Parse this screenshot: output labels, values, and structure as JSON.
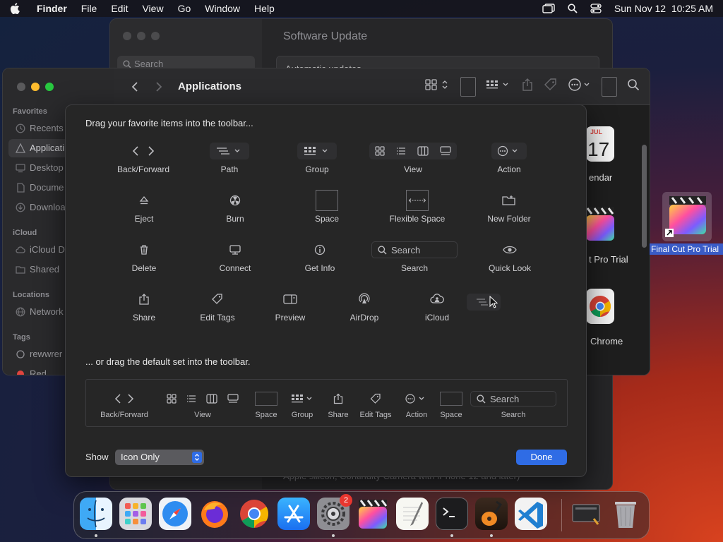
{
  "menubar": {
    "app": "Finder",
    "items": [
      "File",
      "Edit",
      "View",
      "Go",
      "Window",
      "Help"
    ],
    "datetime": "Sun Nov 12  10:25 AM"
  },
  "bg_window": {
    "title": "Software Update",
    "search_placeholder": "Search",
    "auto_updates": "Automatic updates",
    "footnote": "Apple silicon, Continuity Camera with iPhone 12 and later)"
  },
  "finder": {
    "title": "Applications",
    "sidebar": {
      "favorites_header": "Favorites",
      "favorites": [
        "Recents",
        "Applicati",
        "Desktop",
        "Docume",
        "Downloa"
      ],
      "icloud_header": "iCloud",
      "icloud": [
        "iCloud D",
        "Shared"
      ],
      "locations_header": "Locations",
      "locations": [
        "Network"
      ],
      "tags_header": "Tags",
      "tags": [
        "rewwrer",
        "Red"
      ]
    },
    "apps": {
      "calendar": "endar",
      "calendar_month": "JUL",
      "calendar_day": "17",
      "fcp": "t Pro Trial",
      "chrome": "Chrome"
    }
  },
  "desktop": {
    "icon_label": "Final Cut Pro Trial"
  },
  "sheet": {
    "heading": "Drag your favorite items into the toolbar...",
    "heading_default": "... or drag the default set into the toolbar.",
    "items": {
      "back_forward": "Back/Forward",
      "path": "Path",
      "group": "Group",
      "view": "View",
      "action": "Action",
      "eject": "Eject",
      "burn": "Burn",
      "space": "Space",
      "flexible_space": "Flexible Space",
      "new_folder": "New Folder",
      "delete": "Delete",
      "connect": "Connect",
      "get_info": "Get Info",
      "search": "Search",
      "quick_look": "Quick Look",
      "share": "Share",
      "edit_tags": "Edit Tags",
      "preview": "Preview",
      "airdrop": "AirDrop",
      "icloud": "iCloud"
    },
    "search_placeholder": "Search",
    "default_set": {
      "back_forward": "Back/Forward",
      "view": "View",
      "space1": "Space",
      "group": "Group",
      "share": "Share",
      "edit_tags": "Edit Tags",
      "action": "Action",
      "space2": "Space",
      "search": "Search",
      "search_placeholder": "Search"
    },
    "show_label": "Show",
    "show_value": "Icon Only",
    "done_label": "Done"
  },
  "dock": {
    "settings_badge": "2",
    "apps": [
      "Finder",
      "Launchpad",
      "Safari",
      "Firefox",
      "Chrome",
      "App Store",
      "System Settings",
      "Final Cut Pro",
      "TextEdit",
      "Terminal",
      "GarageBand",
      "VS Code",
      "Screenshot",
      "Trash"
    ]
  }
}
